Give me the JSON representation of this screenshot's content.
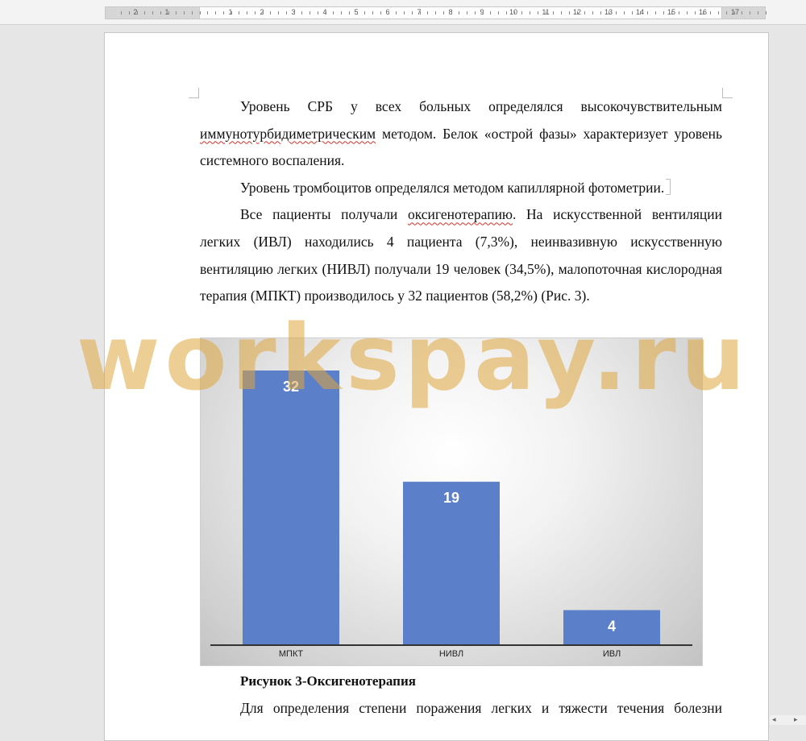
{
  "ruler": {
    "labels": [
      "2",
      "1",
      "1",
      "2",
      "3",
      "4",
      "5",
      "6",
      "7",
      "8",
      "9",
      "10",
      "11",
      "12",
      "13",
      "14",
      "15",
      "16",
      "17"
    ]
  },
  "document": {
    "paragraphs": {
      "p1_a": "Уровень СРБ у всех больных определялся высокочувствительным ",
      "p1_spell": "иммунотурбидиметрическим",
      "p1_b": " методом. Белок «острой фазы» характеризует уровень системного воспаления.",
      "p2": "Уровень тромбоцитов определялся методом капиллярной фотометрии.",
      "p3_a": "Все пациенты получали ",
      "p3_spell": "оксигенотерапию",
      "p3_b": ". На искусственной вентиляции легких (ИВЛ) находились 4 пациента (7,3%), неинвазивную искусственную вентиляцию легких (НИВЛ) получали 19 человек (34,5%), малопоточная кислородная терапия (МПКТ) производилось у 32 пациентов (58,2%) (Рис. 3)."
    },
    "caption": "Рисунок 3-Оксигенотерапия",
    "last_line": "Для определения степени поражения легких и тяжести течения болезни"
  },
  "watermark": "workspay.ru",
  "chart_data": {
    "type": "bar",
    "categories": [
      "МПКТ",
      "НИВЛ",
      "ИВЛ"
    ],
    "values": [
      32,
      19,
      4
    ],
    "data_labels": [
      "32",
      "19",
      "4"
    ],
    "title": "",
    "xlabel": "",
    "ylabel": "",
    "ylim": [
      0,
      32
    ],
    "grid": false,
    "legend": "none",
    "bar_color": "#5b7fc8",
    "label_color": "#ffffff",
    "axis_color": "#333333"
  }
}
